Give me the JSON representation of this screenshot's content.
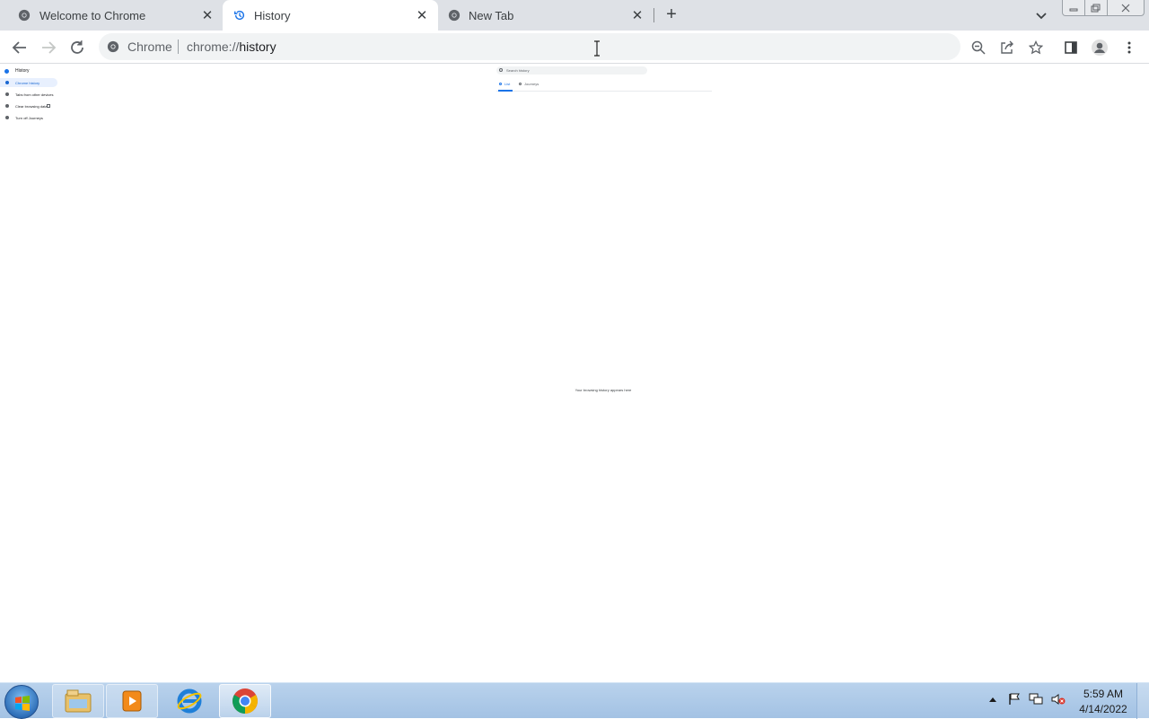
{
  "tabs": [
    {
      "title": "Welcome to Chrome",
      "icon": "chrome-icon",
      "active": false
    },
    {
      "title": "History",
      "icon": "history-icon",
      "active": true
    },
    {
      "title": "New Tab",
      "icon": "chrome-icon",
      "active": false
    }
  ],
  "new_tab_label": "+",
  "toolbar": {
    "site_chip": "Chrome",
    "url_prefix": "chrome://",
    "url_path": "history"
  },
  "history_page": {
    "sidebar_title": "History",
    "sidebar_items": [
      "Chrome history",
      "Tabs from other devices",
      "Clear browsing data",
      "Turn off Journeys"
    ],
    "search_placeholder": "Search history",
    "tabs": [
      "List",
      "Journeys"
    ],
    "empty_message": "Your browsing history appears here"
  },
  "taskbar": {
    "time": "5:59 AM",
    "date": "4/14/2022",
    "apps": [
      "file-explorer-icon",
      "media-player-icon",
      "internet-explorer-icon",
      "chrome-icon"
    ]
  },
  "colors": {
    "accent": "#1a73e8",
    "tabstrip_bg": "#dee1e6",
    "omnibox_bg": "#f1f3f4",
    "taskbar_bg": "#a3c2e4"
  }
}
